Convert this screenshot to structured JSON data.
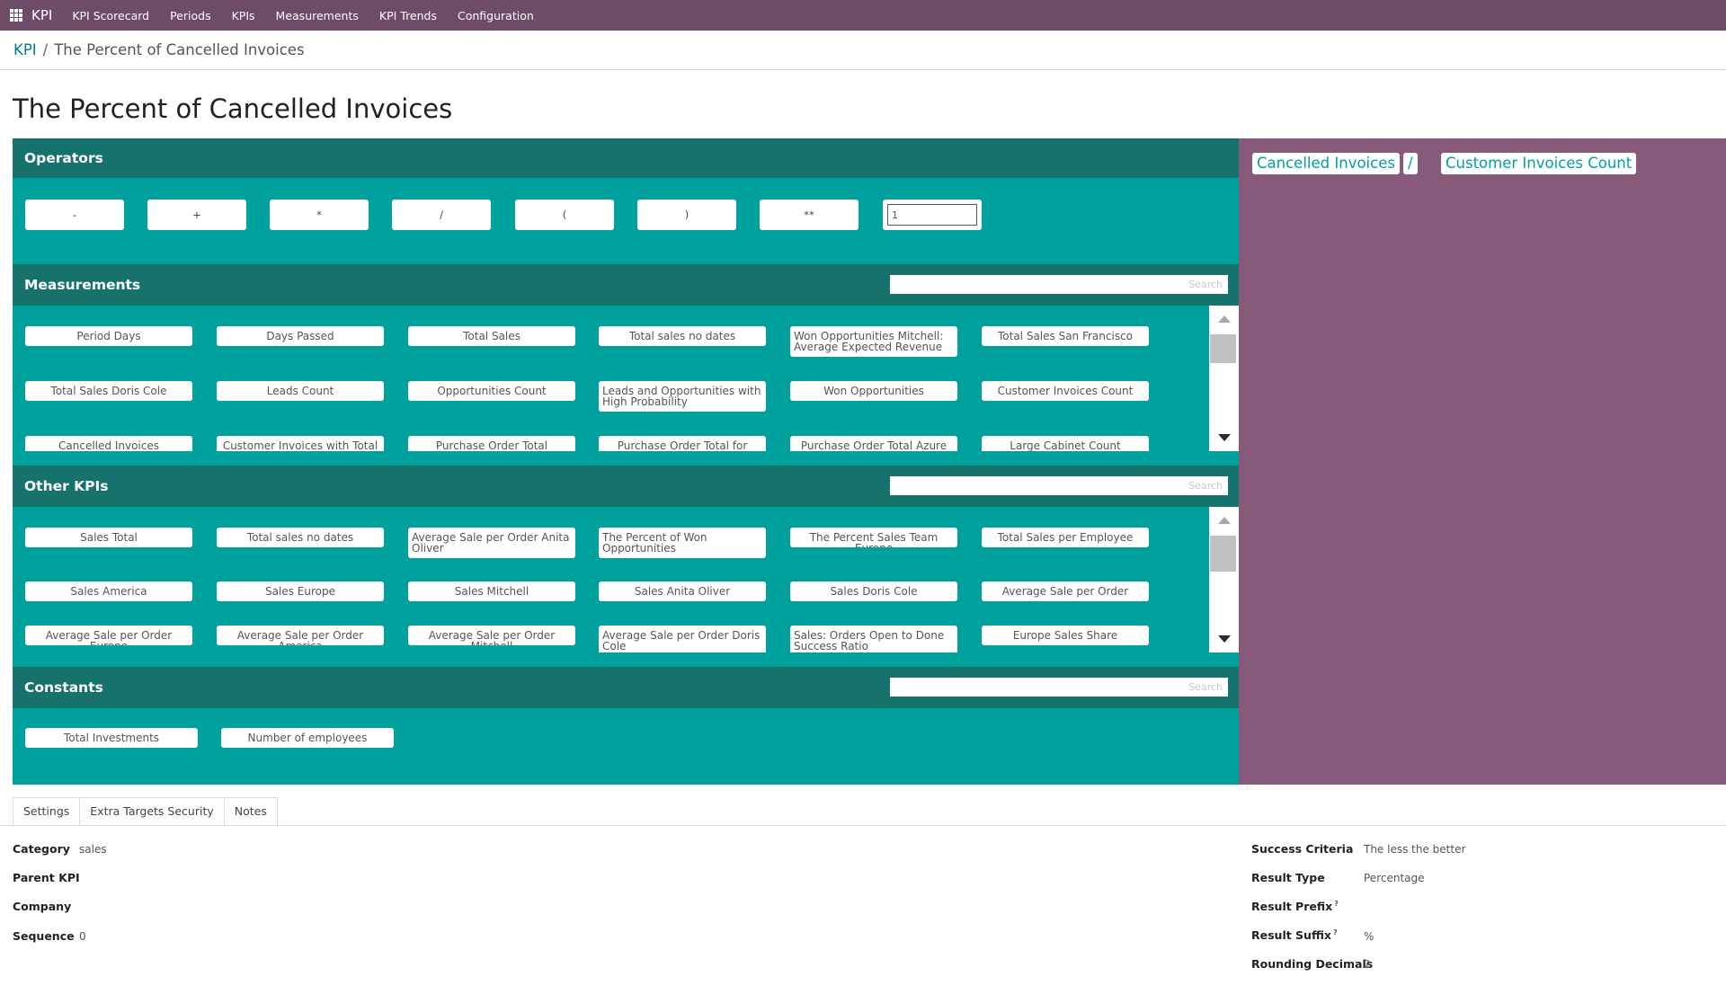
{
  "topbar": {
    "brand": "KPI",
    "menu": [
      "KPI Scorecard",
      "Periods",
      "KPIs",
      "Measurements",
      "KPI Trends",
      "Configuration"
    ]
  },
  "breadcrumb": {
    "parent": "KPI",
    "separator": "/",
    "current": "The Percent of Cancelled Invoices"
  },
  "page_title": "The Percent of Cancelled Invoices",
  "operators": {
    "title": "Operators",
    "buttons": [
      "-",
      "+",
      "*",
      "/",
      "(",
      ")",
      "**"
    ],
    "input_value": "1"
  },
  "measurements": {
    "title": "Measurements",
    "search_placeholder": "Search",
    "items": [
      "Period Days",
      "Days Passed",
      "Total Sales",
      "Total sales no dates",
      "Won Opportunities Mitchell: Average Expected Revenue",
      "Total Sales San Francisco",
      "Total Sales Doris Cole",
      "Leads Count",
      "Opportunities Count",
      "Leads and Opportunities with High Probability",
      "Won Opportunities",
      "Customer Invoices Count",
      "Cancelled Invoices",
      "Customer Invoices with Total >",
      "Purchase Order Total",
      "Purchase Order Total for Orders",
      "Purchase Order Total Azure",
      "Large Cabinet Count"
    ]
  },
  "other_kpis": {
    "title": "Other KPIs",
    "search_placeholder": "Search",
    "items": [
      "Sales Total",
      "Total sales no dates",
      "Average Sale per Order Anita Oliver",
      "The Percent of Won Opportunities",
      "The Percent Sales Team Europe",
      "Total Sales per Employee",
      "Sales America",
      "Sales Europe",
      "Sales Mitchell",
      "Sales Anita Oliver",
      "Sales Doris Cole",
      "Average Sale per Order",
      "Average Sale per Order Europe",
      "Average Sale per Order America",
      "Average Sale per Order Mitchell",
      "Average Sale per Order Doris Cole",
      "Sales: Orders Open to Done Success Ratio",
      "Europe Sales Share"
    ]
  },
  "constants": {
    "title": "Constants",
    "search_placeholder": "Search",
    "items": [
      "Total Investments",
      "Number of employees"
    ]
  },
  "formula": {
    "tokens": [
      "Cancelled Invoices",
      "/",
      "Customer Invoices Count"
    ]
  },
  "tabs": [
    "Settings",
    "Extra Targets Security",
    "Notes"
  ],
  "settings": {
    "left": {
      "category_label": "Category",
      "category_value": "sales",
      "parent_label": "Parent KPI",
      "parent_value": "",
      "company_label": "Company",
      "company_value": "",
      "sequence_label": "Sequence",
      "sequence_value": "0"
    },
    "right": {
      "success_label": "Success Criteria",
      "success_value": "The less the better",
      "result_type_label": "Result Type",
      "result_type_value": "Percentage",
      "prefix_label": "Result Prefix",
      "prefix_value": "",
      "suffix_label": "Result Suffix",
      "suffix_value": "%",
      "rounding_label": "Rounding Decimals",
      "rounding_value": "2",
      "help_mark": "?"
    }
  },
  "colors": {
    "topbar": "#6e4c67",
    "builder": "#00a09d",
    "section_header": "#17716d",
    "preview": "#875a7b"
  }
}
